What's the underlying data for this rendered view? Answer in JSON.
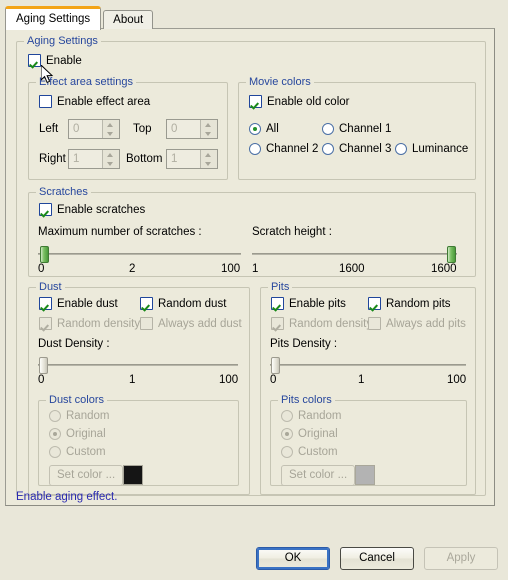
{
  "tabs": [
    {
      "label": "Aging Settings",
      "active": true
    },
    {
      "label": "About",
      "active": false
    }
  ],
  "aging_settings": {
    "group_label": "Aging Settings",
    "enable": {
      "label": "Enable",
      "checked": true,
      "enabled": true
    },
    "effect_area": {
      "group_label": "Effect area settings",
      "enable": {
        "label": "Enable effect area",
        "checked": false,
        "enabled": true
      },
      "fields": [
        {
          "label": "Left",
          "value": "0"
        },
        {
          "label": "Top",
          "value": "0"
        },
        {
          "label": "Right",
          "value": "1"
        },
        {
          "label": "Bottom",
          "value": "1"
        }
      ]
    },
    "movie_colors": {
      "group_label": "Movie colors",
      "enable_old_color": {
        "label": "Enable old color",
        "checked": true
      },
      "options": [
        {
          "label": "All",
          "selected": true
        },
        {
          "label": "Channel 1",
          "selected": false
        },
        {
          "label": "Channel 2",
          "selected": false
        },
        {
          "label": "Channel 3",
          "selected": false
        },
        {
          "label": "Luminance",
          "selected": false
        }
      ]
    },
    "scratches": {
      "group_label": "Scratches",
      "enable": {
        "label": "Enable scratches",
        "checked": true
      },
      "max_scratches": {
        "label": "Maximum number of scratches :",
        "min": "0",
        "mid": "2",
        "max": "100",
        "value": 2,
        "percent": 2
      },
      "scratch_height": {
        "label": "Scratch height :",
        "min": "1",
        "mid": "1600",
        "max": "1600",
        "value": 1600,
        "percent": 100
      }
    },
    "dust": {
      "group_label": "Dust",
      "enable": {
        "label": "Enable dust",
        "checked": true,
        "enabled": true
      },
      "random": {
        "label": "Random dust",
        "checked": true,
        "enabled": true
      },
      "random_density": {
        "label": "Random density",
        "checked": true,
        "enabled": false
      },
      "always_add": {
        "label": "Always add dust",
        "checked": false,
        "enabled": false
      },
      "density": {
        "label": "Dust Density :",
        "min": "0",
        "mid": "1",
        "max": "100",
        "value": 1,
        "percent": 1
      },
      "colors": {
        "group_label": "Dust colors",
        "options": [
          {
            "label": "Random",
            "selected": false
          },
          {
            "label": "Original",
            "selected": true
          },
          {
            "label": "Custom",
            "selected": false
          }
        ],
        "set_color_label": "Set color ...",
        "swatch_color": "#151515"
      }
    },
    "pits": {
      "group_label": "Pits",
      "enable": {
        "label": "Enable pits",
        "checked": true,
        "enabled": true
      },
      "random": {
        "label": "Random pits",
        "checked": true,
        "enabled": true
      },
      "random_density": {
        "label": "Random density",
        "checked": true,
        "enabled": false
      },
      "always_add": {
        "label": "Always add pits",
        "checked": false,
        "enabled": false
      },
      "density": {
        "label": "Pits Density :",
        "min": "0",
        "mid": "1",
        "max": "100",
        "value": 1,
        "percent": 1
      },
      "colors": {
        "group_label": "Pits colors",
        "options": [
          {
            "label": "Random",
            "selected": false
          },
          {
            "label": "Original",
            "selected": true
          },
          {
            "label": "Custom",
            "selected": false
          }
        ],
        "set_color_label": "Set color ...",
        "swatch_color": "#b3b3b3"
      }
    }
  },
  "hint": "Enable aging effect.",
  "buttons": {
    "ok": "OK",
    "cancel": "Cancel",
    "apply": "Apply"
  }
}
